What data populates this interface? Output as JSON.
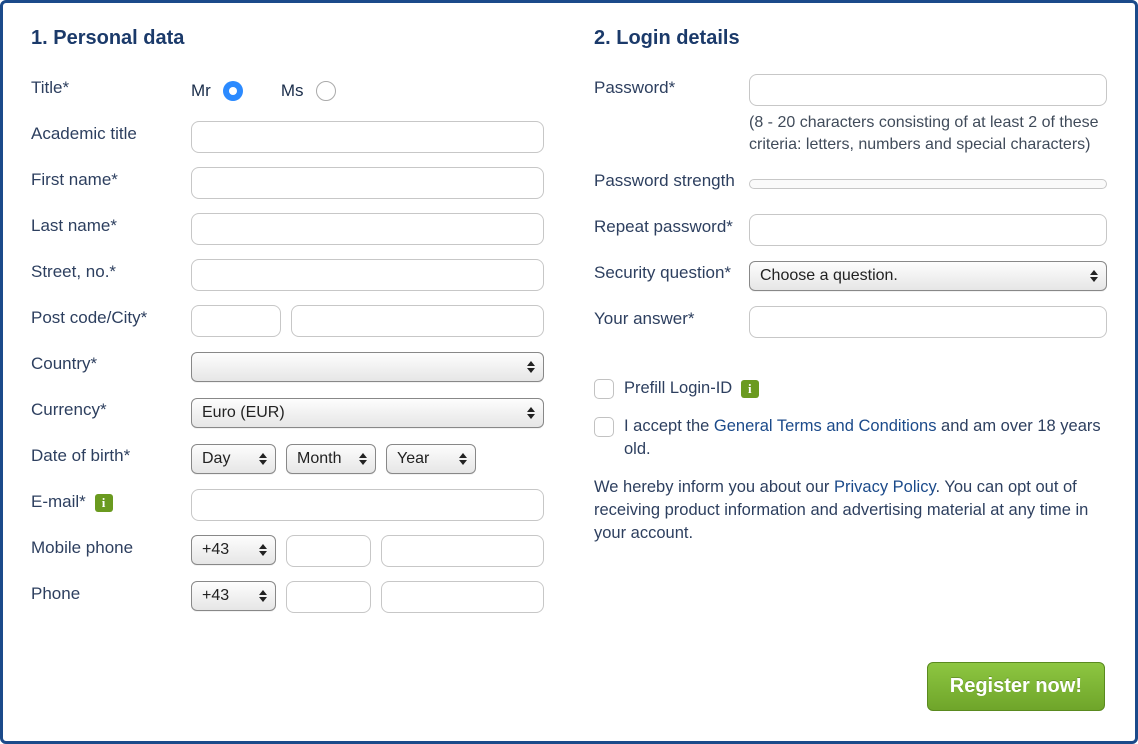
{
  "section1": {
    "heading": "1. Personal data",
    "labels": {
      "title": "Title*",
      "academic": "Academic title",
      "first": "First name*",
      "last": "Last name*",
      "street": "Street, no.*",
      "postcity": "Post code/City*",
      "country": "Country*",
      "currency": "Currency*",
      "dob": "Date of birth*",
      "email": "E-mail*",
      "mobile": "Mobile phone",
      "phone": "Phone"
    },
    "title_options": {
      "mr": "Mr",
      "ms": "Ms"
    },
    "currency_value": "Euro (EUR)",
    "dob_day": "Day",
    "dob_month": "Month",
    "dob_year": "Year",
    "phone_code": "+43"
  },
  "section2": {
    "heading": "2. Login details",
    "labels": {
      "password": "Password*",
      "strength": "Password strength",
      "repeat": "Repeat password*",
      "secq": "Security question*",
      "answer": "Your answer*"
    },
    "password_hint": "(8 - 20 characters consisting of at least 2 of these criteria: letters, numbers and special characters)",
    "secq_value": "Choose a question.",
    "prefill_label": "Prefill Login-ID",
    "terms_pre": "I accept the ",
    "terms_link": "General Terms and Conditions",
    "terms_post": " and am over 18 years old.",
    "privacy_pre": "We hereby inform you about our ",
    "privacy_link": "Privacy Policy",
    "privacy_post": ". You can opt out of receiving product information and advertising material at any time in your account."
  },
  "register_button": "Register now!"
}
